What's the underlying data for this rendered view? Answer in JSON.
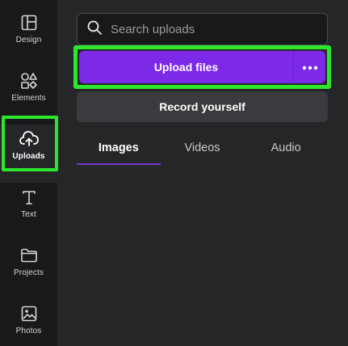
{
  "rail": {
    "items": [
      {
        "label": "Design",
        "icon": "design-icon"
      },
      {
        "label": "Elements",
        "icon": "elements-icon"
      },
      {
        "label": "Uploads",
        "icon": "cloud-upload-icon",
        "active": true
      },
      {
        "label": "Text",
        "icon": "text-icon"
      },
      {
        "label": "Projects",
        "icon": "folder-icon"
      },
      {
        "label": "Photos",
        "icon": "image-icon"
      }
    ]
  },
  "search": {
    "placeholder": "Search uploads",
    "icon": "search-icon"
  },
  "upload": {
    "label": "Upload files",
    "more_icon": "more-dots-icon"
  },
  "record": {
    "label": "Record yourself"
  },
  "tabs": [
    {
      "label": "Images",
      "active": true
    },
    {
      "label": "Videos"
    },
    {
      "label": "Audio"
    }
  ],
  "colors": {
    "accent": "#7d2ae8",
    "highlight": "#2ee52e",
    "rail_bg": "#18191b",
    "panel_bg": "#252627"
  }
}
